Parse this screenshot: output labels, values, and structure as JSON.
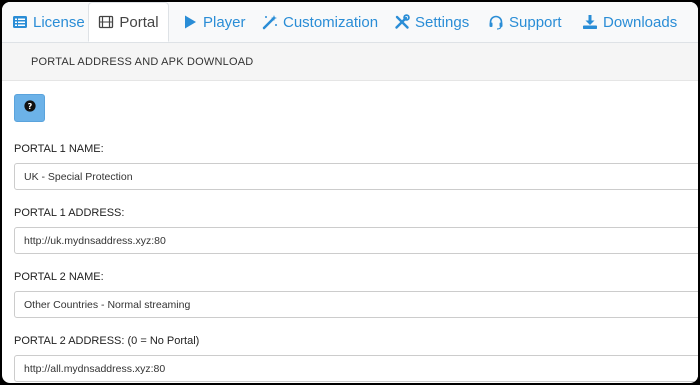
{
  "tabs": [
    {
      "label": "License",
      "icon": "list-icon"
    },
    {
      "label": "Portal",
      "icon": "film-icon",
      "active": true
    },
    {
      "label": "Player",
      "icon": "play-icon"
    },
    {
      "label": "Customization",
      "icon": "magic-wand-icon"
    },
    {
      "label": "Settings",
      "icon": "tools-icon"
    },
    {
      "label": "Support",
      "icon": "headset-icon"
    },
    {
      "label": "Downloads",
      "icon": "download-icon"
    }
  ],
  "section": {
    "title": "PORTAL ADDRESS AND APK DOWNLOAD"
  },
  "help_button": {
    "icon": "question-circle-icon"
  },
  "form": {
    "portal1_name_label": "PORTAL 1 NAME:",
    "portal1_name_value": "UK - Special Protection",
    "portal1_address_label": "PORTAL 1 ADDRESS:",
    "portal1_address_value": "http://uk.mydnsaddress.xyz:80",
    "portal2_name_label": "PORTAL 2 NAME:",
    "portal2_name_value": "Other Countries - Normal streaming",
    "portal2_address_label": "PORTAL 2 ADDRESS: (0 = No Portal)",
    "portal2_address_value": "http://all.mydnsaddress.xyz:80"
  },
  "colors": {
    "accent": "#2a8dd6",
    "help_button": "#6cb2e8"
  }
}
